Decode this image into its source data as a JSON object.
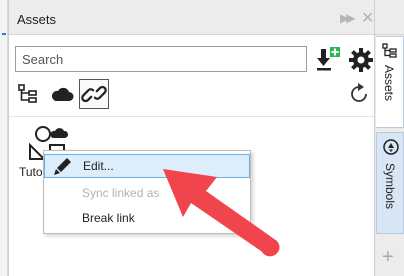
{
  "panel": {
    "title": "Assets",
    "pin_glyph": "▶▶",
    "close_glyph": "✕"
  },
  "search": {
    "placeholder": "Search"
  },
  "toolbar": {
    "import_icon": "import-download-icon",
    "settings_icon": "gear-icon",
    "filters": [
      "tree-icon",
      "cloud-icon",
      "link-icon"
    ],
    "refresh_icon": "refresh-icon"
  },
  "asset": {
    "label": "Tuto"
  },
  "context_menu": {
    "items": [
      {
        "label": "Edit...",
        "enabled": true,
        "highlighted": true,
        "icon": "pencil-icon"
      },
      {
        "label": "Sync linked as",
        "enabled": false
      },
      {
        "label": "Break link",
        "enabled": true
      }
    ]
  },
  "right_sidebar": {
    "tabs": [
      {
        "label": "Assets",
        "active": true
      },
      {
        "label": "Symbols",
        "active": false
      }
    ],
    "add_glyph": "+"
  },
  "colors": {
    "accent_blue": "#2e7bd6",
    "menu_highlight": "#dceefc",
    "arrow_red": "#f0454d",
    "plus_green": "#2db84a"
  }
}
